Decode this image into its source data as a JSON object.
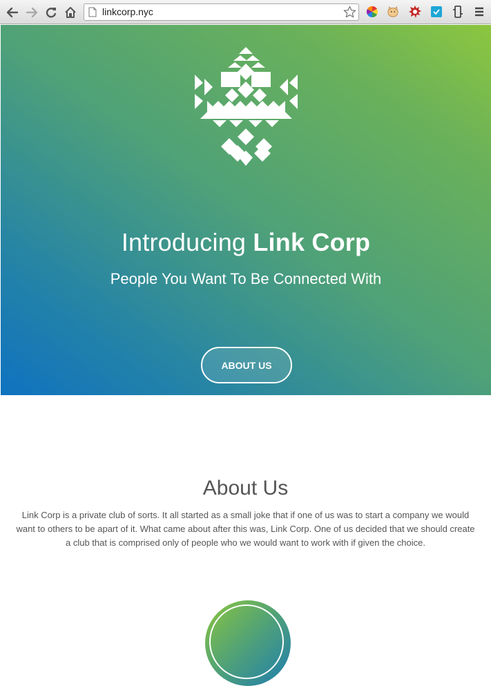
{
  "browser": {
    "url": "linkcorp.nyc",
    "icons": [
      "back-icon",
      "forward-icon",
      "reload-icon",
      "home-icon",
      "bookmark-star-icon",
      "color-wheel-extension-icon",
      "cat-extension-icon",
      "gear-extension-icon",
      "checkbox-extension-icon",
      "device-extension-icon",
      "menu-icon"
    ]
  },
  "hero": {
    "title_intro": "Introducing ",
    "title_brand": "Link Corp",
    "subtitle": "People You Want To Be Connected With",
    "button_label": "ABOUT US",
    "logo_icon": "geometric-diamond-logo"
  },
  "about": {
    "title": "About Us",
    "text": "Link Corp is a private club of sorts. It all started as a small joke that if one of us was to start a company we would want to others to be apart of it. What came about after this was, Link Corp. One of us decided that we should create a club that is comprised only of people who we would want to work with if given the choice."
  },
  "colors": {
    "gradient_top_right": "#8cc63f",
    "gradient_bottom_left": "#0f72c0",
    "text_gray": "#555555"
  }
}
